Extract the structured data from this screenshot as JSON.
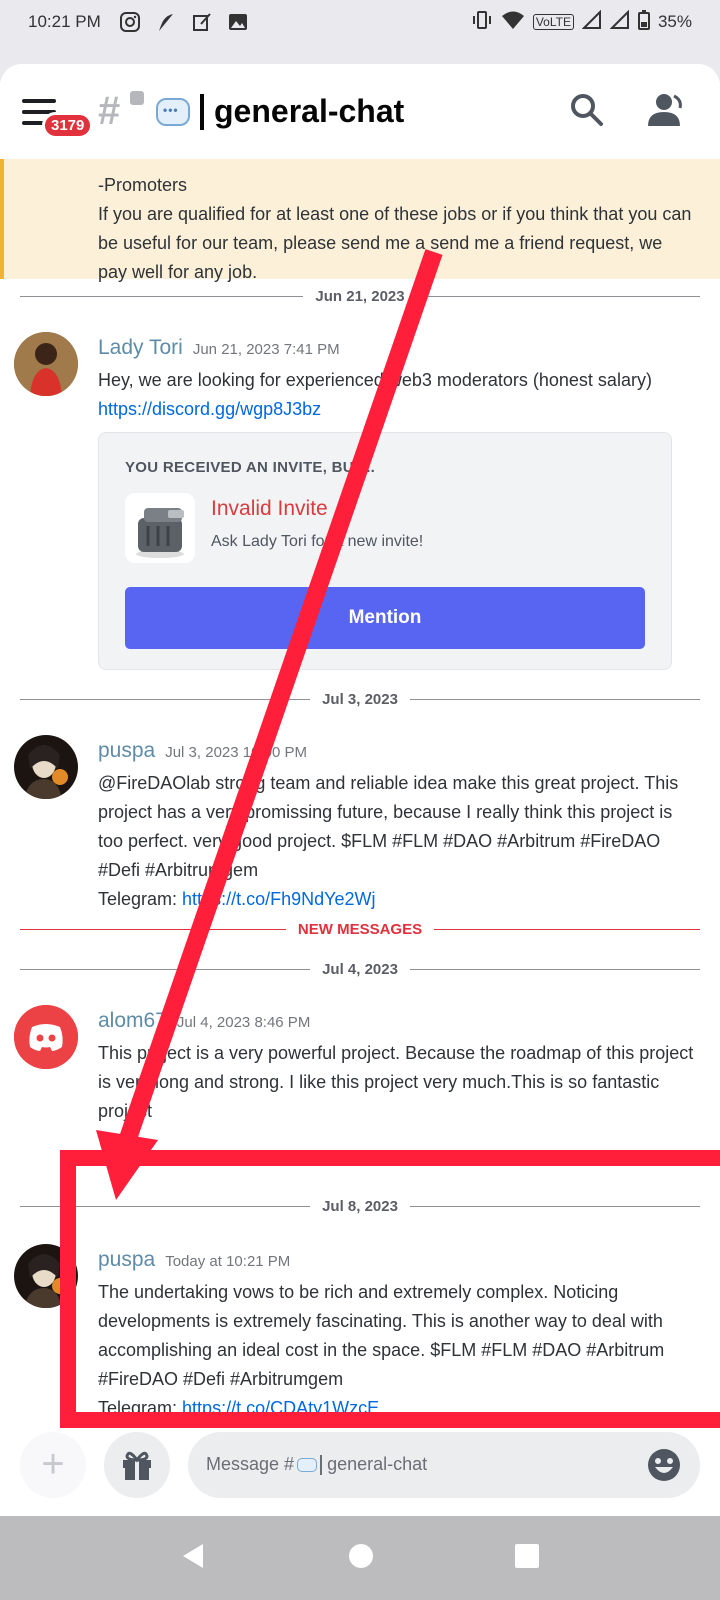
{
  "status_bar": {
    "time": "10:21 PM",
    "volte": "VoLTE",
    "battery": "35%"
  },
  "header": {
    "badge": "3179",
    "channel_name": "general-chat"
  },
  "highlight": {
    "line1": "-Promoters",
    "line2": "If you are qualified for at least one of these jobs or if you think that you can be useful for our team, please send me a send me a friend request, we pay well for any job."
  },
  "dividers": {
    "d1": "Jun 21, 2023",
    "d2": "Jul 3, 2023",
    "new": "NEW MESSAGES",
    "d3": "Jul 4, 2023",
    "d4": "Jul 8, 2023"
  },
  "messages": [
    {
      "author": "Lady Tori",
      "timestamp": "Jun 21, 2023 7:41 PM",
      "text": "Hey, we are looking for experienced web3 moderators (honest salary)",
      "link": "https://discord.gg/wgp8J3bz"
    },
    {
      "author": "puspa",
      "timestamp": "Jul 3, 2023 10:00 PM",
      "text": "@FireDAOlab strong team and reliable idea make this great project. This project has a very promissing future, because I really think this project is too perfect. very good project. $FLM #FLM #DAO #Arbitrum #FireDAO #Defi #Arbitrumgem",
      "link_prefix": "Telegram: ",
      "link": "https://t.co/Fh9NdYe2Wj"
    },
    {
      "author": "alom67",
      "timestamp": "Jul 4, 2023 8:46 PM",
      "text": "This project is a very powerful project. Because the roadmap of this project is very long and strong. I like this project very much.This is so fantastic project"
    },
    {
      "author": "puspa",
      "timestamp": "Today at 10:21 PM",
      "text": "The undertaking vows to be rich and extremely complex. Noticing developments is extremely fascinating. This is another way to deal with accomplishing an ideal cost in the space. $FLM #FLM #DAO #Arbitrum #FireDAO #Defi #Arbitrumgem",
      "link_prefix": "Telegram: ",
      "link": "https://t.co/CDAty1WzcE"
    }
  ],
  "invite": {
    "title": "YOU RECEIVED AN INVITE, BUT...",
    "name": "Invalid Invite",
    "subtitle": "Ask Lady Tori for a new invite!",
    "button": "Mention"
  },
  "composer": {
    "placeholder_prefix": "Message #",
    "placeholder_channel": "general-chat"
  },
  "colors": {
    "accent": "#5865f2",
    "annotation": "#ff1f3a",
    "link": "#0068e0",
    "new_messages": "#e0313c"
  }
}
